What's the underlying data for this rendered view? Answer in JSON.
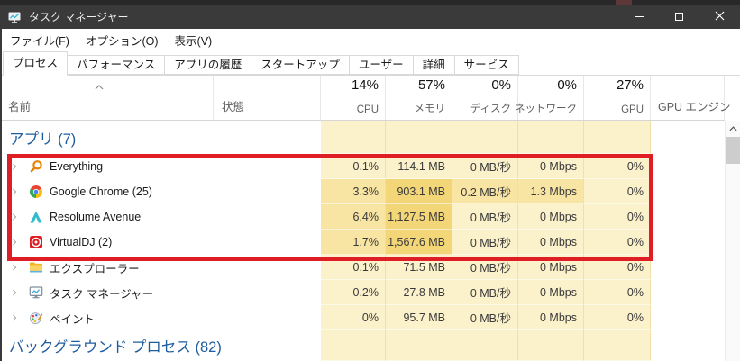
{
  "window": {
    "title": "タスク マネージャー"
  },
  "menu": {
    "items": [
      "ファイル(F)",
      "オプション(O)",
      "表示(V)"
    ]
  },
  "tabs": {
    "active": "プロセス",
    "items": [
      "プロセス",
      "パフォーマンス",
      "アプリの履歴",
      "スタートアップ",
      "ユーザー",
      "詳細",
      "サービス"
    ]
  },
  "table": {
    "columns": {
      "name": {
        "label": "名前"
      },
      "status": {
        "label": "状態"
      },
      "cpu": {
        "total": "14%",
        "label": "CPU"
      },
      "memory": {
        "total": "57%",
        "label": "メモリ"
      },
      "disk": {
        "total": "0%",
        "label": "ディスク"
      },
      "network": {
        "total": "0%",
        "label": "ネットワーク"
      },
      "gpu": {
        "total": "27%",
        "label": "GPU"
      },
      "gpu_engine": {
        "label": "GPU エンジン"
      }
    },
    "rows": [
      {
        "type": "group",
        "name": "アプリ (7)"
      },
      {
        "type": "process",
        "name": "Everything",
        "icon": "everything-icon",
        "cpu": "0.1%",
        "memory": "114.1 MB",
        "disk": "0 MB/秒",
        "network": "0 Mbps",
        "gpu": "0%",
        "gpu_engine": "",
        "shades": [
          "l",
          "l",
          "l",
          "l",
          "l"
        ]
      },
      {
        "type": "process",
        "name": "Google Chrome (25)",
        "icon": "chrome-icon",
        "cpu": "3.3%",
        "memory": "903.1 MB",
        "disk": "0.2 MB/秒",
        "network": "1.3 Mbps",
        "gpu": "0%",
        "gpu_engine": "",
        "shades": [
          "m",
          "d",
          "m",
          "m",
          "l"
        ]
      },
      {
        "type": "process",
        "name": "Resolume Avenue",
        "icon": "resolume-icon",
        "cpu": "6.4%",
        "memory": "1,127.5 MB",
        "disk": "0 MB/秒",
        "network": "0 Mbps",
        "gpu": "0%",
        "gpu_engine": "",
        "shades": [
          "m",
          "d",
          "l",
          "l",
          "l"
        ]
      },
      {
        "type": "process",
        "name": "VirtualDJ (2)",
        "icon": "virtualdj-icon",
        "cpu": "1.7%",
        "memory": "1,567.6 MB",
        "disk": "0 MB/秒",
        "network": "0 Mbps",
        "gpu": "0%",
        "gpu_engine": "",
        "shades": [
          "m",
          "d",
          "l",
          "l",
          "l"
        ]
      },
      {
        "type": "process",
        "name": "エクスプローラー",
        "icon": "explorer-icon",
        "cpu": "0.1%",
        "memory": "71.5 MB",
        "disk": "0 MB/秒",
        "network": "0 Mbps",
        "gpu": "0%",
        "gpu_engine": "",
        "shades": [
          "l",
          "l",
          "l",
          "l",
          "l"
        ]
      },
      {
        "type": "process",
        "name": "タスク マネージャー",
        "icon": "taskmanager-icon",
        "cpu": "0.2%",
        "memory": "27.8 MB",
        "disk": "0 MB/秒",
        "network": "0 Mbps",
        "gpu": "0%",
        "gpu_engine": "",
        "shades": [
          "l",
          "l",
          "l",
          "l",
          "l"
        ]
      },
      {
        "type": "process",
        "name": "ペイント",
        "icon": "paint-icon",
        "cpu": "0%",
        "memory": "95.7 MB",
        "disk": "0 MB/秒",
        "network": "0 Mbps",
        "gpu": "0%",
        "gpu_engine": "",
        "shades": [
          "l",
          "l",
          "l",
          "l",
          "l"
        ]
      },
      {
        "type": "group",
        "name": "バックグラウンド プロセス (82)",
        "last": true
      }
    ]
  },
  "annotation": {
    "type": "red-rectangle",
    "color": "#df1d24"
  },
  "colors": {
    "titlebar": "#3a3a3a",
    "heat_light": "#fbf1cb",
    "heat_medium": "#f8e5a3",
    "heat_dark": "#f3d678",
    "group_text": "#1e5c9e"
  }
}
